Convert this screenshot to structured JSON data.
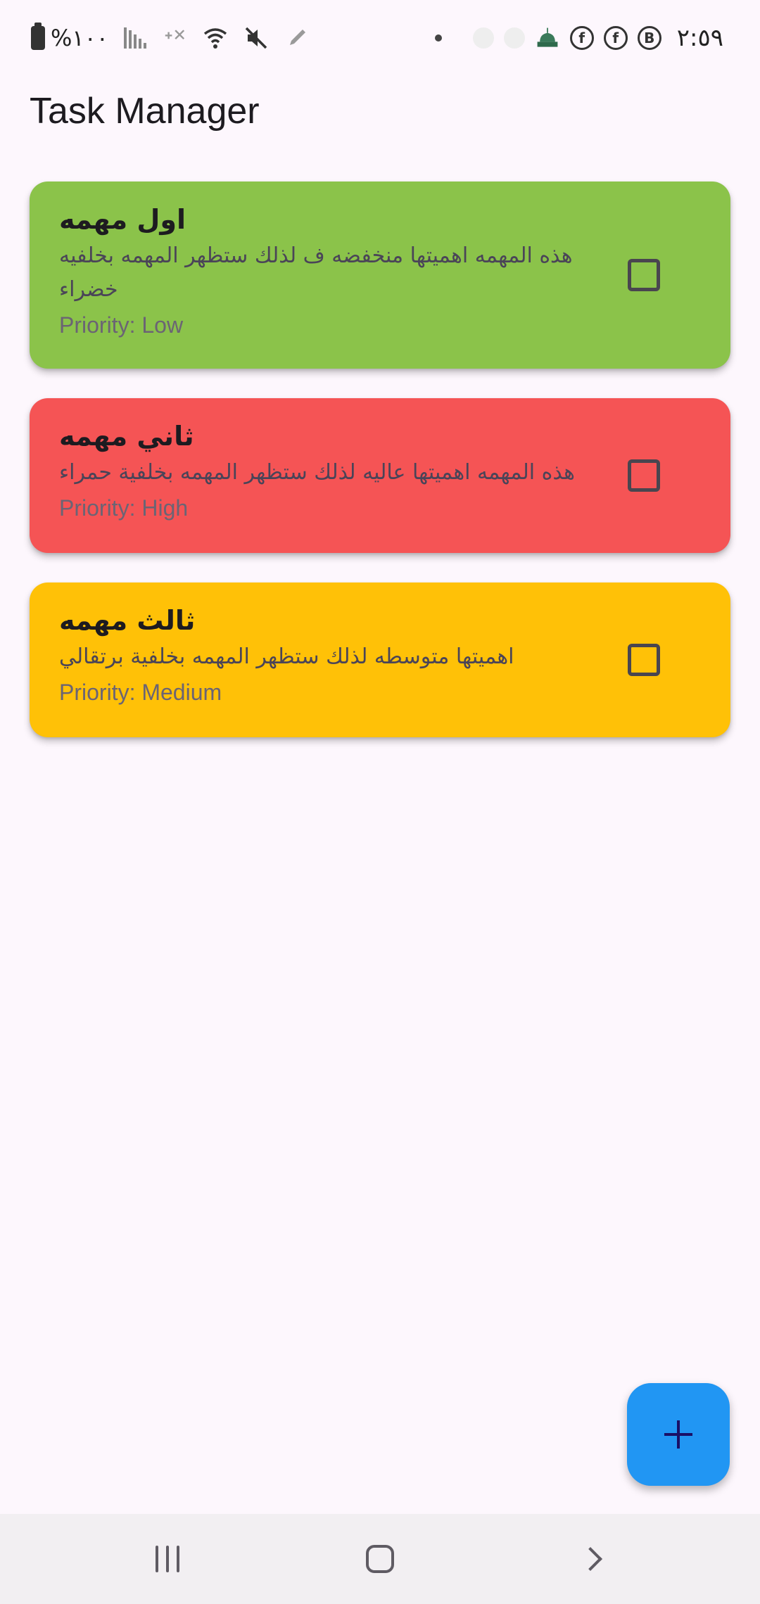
{
  "status_bar": {
    "battery_text": "%١٠٠",
    "time": "٢:٥٩",
    "icons": [
      "battery-icon",
      "signal-icon",
      "no-signal-icon",
      "wifi-icon",
      "mute-icon",
      "pen-icon",
      "dot-icon",
      "mosque-app-icon",
      "facebook-icon",
      "facebook-icon",
      "business-icon"
    ]
  },
  "app_bar": {
    "title": "Task Manager"
  },
  "tasks": [
    {
      "title": "اول مهمه",
      "description": "هذه المهمه اهميتها منخفضه ف لذلك ستظهر المهمه بخلفيه خضراء",
      "priority": "Priority: Low",
      "color": "#8bc34a",
      "checked": false
    },
    {
      "title": "ثاني مهمه",
      "description": "هذه المهمه اهميتها عاليه لذلك ستظهر المهمه بخلفية حمراء",
      "priority": "Priority: High",
      "color": "#f55455",
      "checked": false
    },
    {
      "title": "ثالث مهمه",
      "description": "اهميتها متوسطه لذلك ستظهر المهمه بخلفية برتقالي",
      "priority": "Priority: Medium",
      "color": "#ffc107",
      "checked": false
    }
  ],
  "fab": {
    "icon": "plus-icon",
    "color": "#2196f3"
  },
  "nav_bar": {
    "icons": [
      "recents-icon",
      "home-icon",
      "back-icon"
    ]
  }
}
